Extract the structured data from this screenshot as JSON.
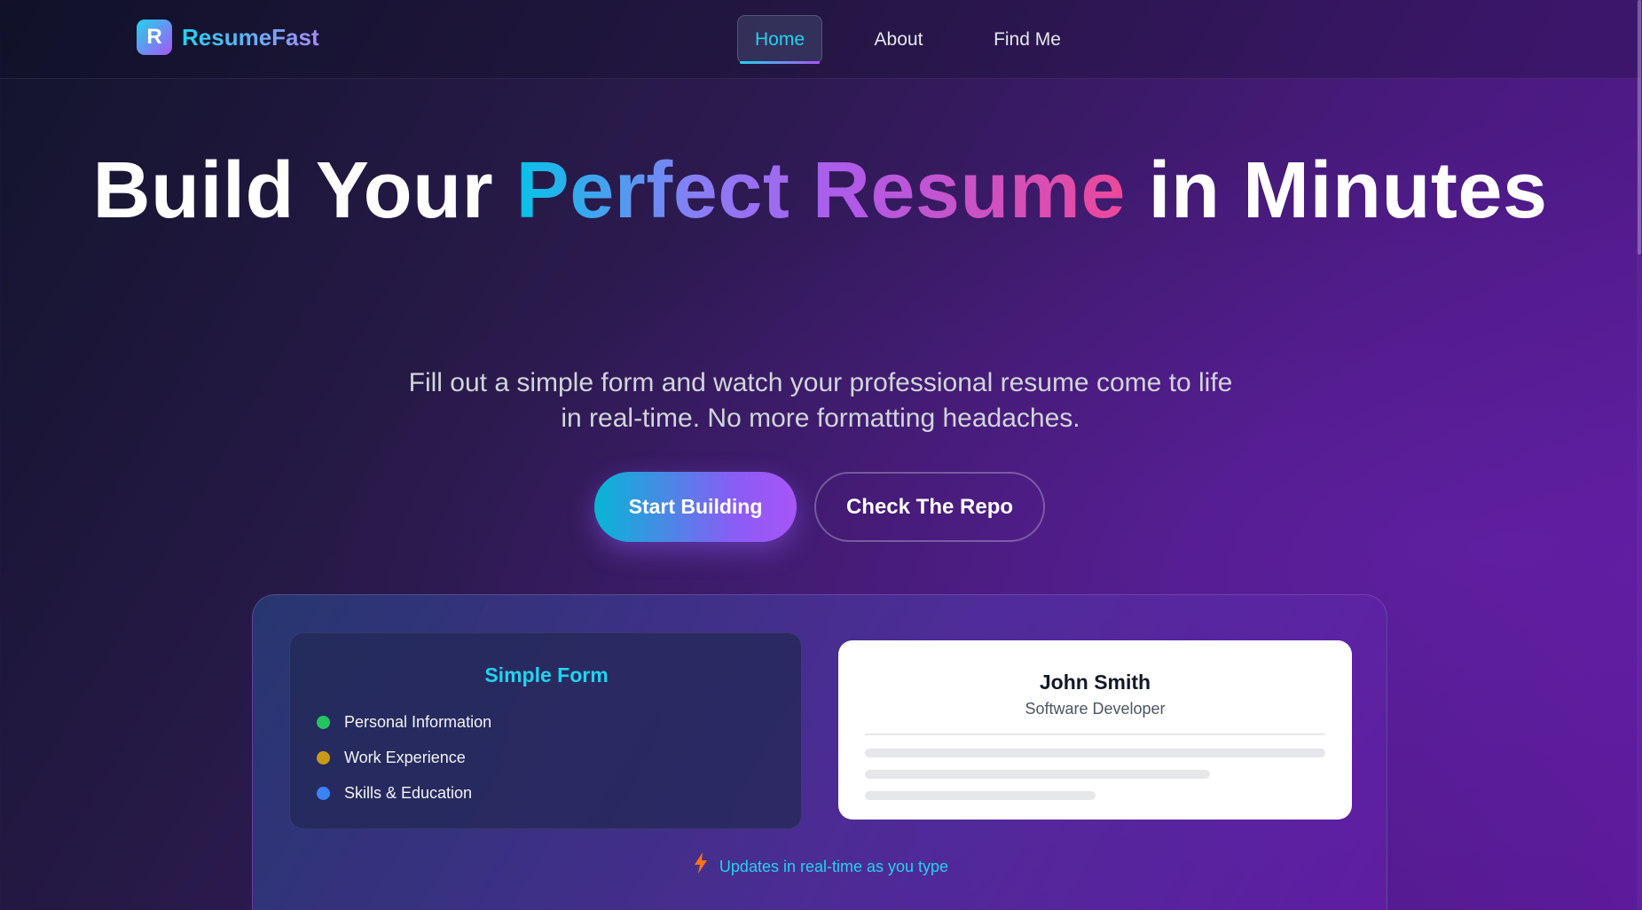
{
  "nav": {
    "brand_letter": "R",
    "brand_name": "ResumeFast",
    "links": [
      "Home",
      "About",
      "Find Me"
    ],
    "active": "Home"
  },
  "hero": {
    "title_part1": "Build Your ",
    "title_highlight": "Perfect Resume",
    "title_part2": " in Minutes",
    "subtitle": "Fill out a simple form and watch your professional resume come to life in real-time. No more formatting headaches.",
    "primary_button": "Start Building",
    "secondary_button": "Check The Repo"
  },
  "preview": {
    "form": {
      "title": "Simple Form",
      "items": [
        {
          "label": "Personal Information",
          "color": "#22c55e"
        },
        {
          "label": "Work Experience",
          "color": "#ca9a17"
        },
        {
          "label": "Skills & Education",
          "color": "#3b82f6"
        }
      ]
    },
    "resume": {
      "name": "John Smith",
      "role": "Software Developer"
    },
    "note": "Updates in real-time as you type",
    "note_icon": "lightning-bolt-icon"
  },
  "colors": {
    "accent_cyan": "#22d3ee",
    "accent_purple": "#a855f7",
    "accent_pink": "#ec4899"
  }
}
